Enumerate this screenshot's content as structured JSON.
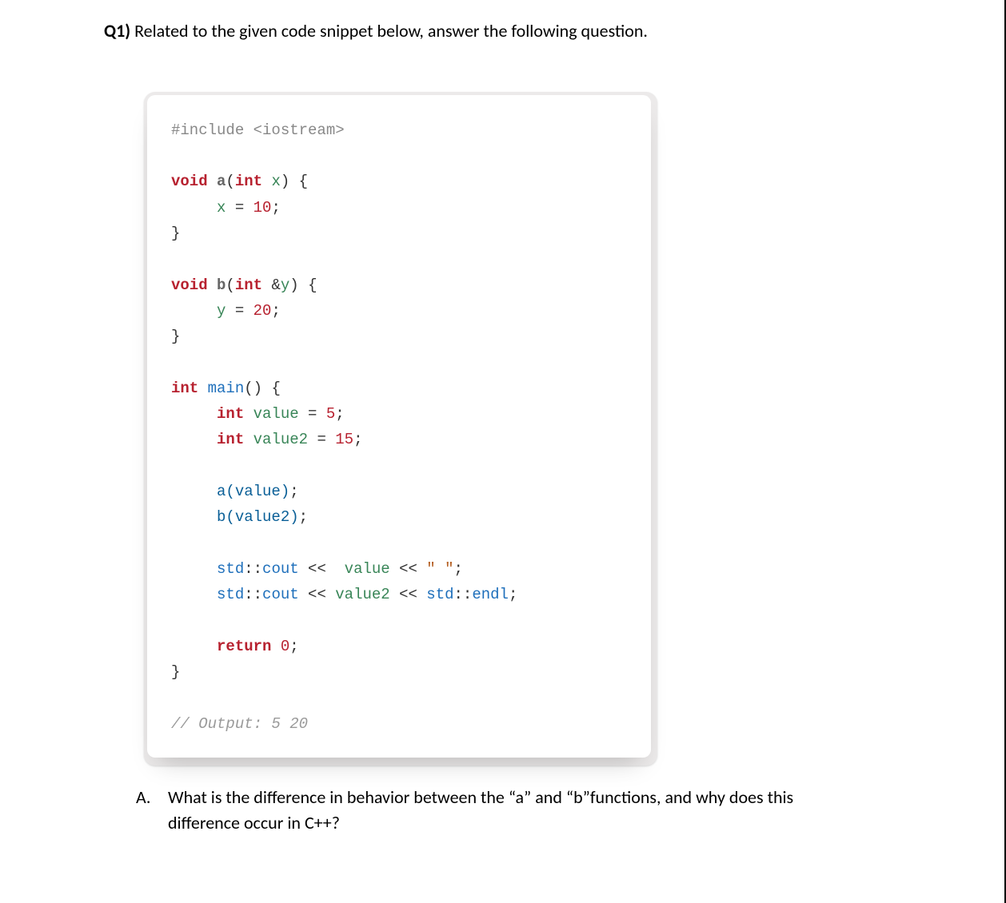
{
  "question": {
    "number": "Q1)",
    "prompt": "Related to the given code snippet below, answer the following question."
  },
  "code": {
    "l01_pp": "#include <iostream>",
    "l03_kw_void": "void",
    "l03_fn_a": "a",
    "l03_sig_open": "(",
    "l03_type_int": "int",
    "l03_param_x": "x",
    "l03_sig_close": ") {",
    "l04_var_x": "x",
    "l04_eq": " = ",
    "l04_num": "10",
    "l04_semi": ";",
    "l05_brace": "}",
    "l07_kw_void": "void",
    "l07_fn_b": "b",
    "l07_sig_open": "(",
    "l07_type_int": "int",
    "l07_amp": "&",
    "l07_param_y": "y",
    "l07_sig_close": ") {",
    "l08_var_y": "y",
    "l08_eq": " = ",
    "l08_num": "20",
    "l08_semi": ";",
    "l09_brace": "}",
    "l11_type_int": "int",
    "l11_fn_main": "main",
    "l11_sig": "() {",
    "l12_type_int": "int",
    "l12_var_value": "value",
    "l12_eq": " = ",
    "l12_num": "5",
    "l12_semi": ";",
    "l13_type_int": "int",
    "l13_var_value2": "value2",
    "l13_eq": " = ",
    "l13_num": "15",
    "l13_semi": ";",
    "l15_call_a": "a",
    "l15_arg": "(value)",
    "l15_semi": ";",
    "l16_call_b": "b",
    "l16_arg": "(value2)",
    "l16_semi": ";",
    "l18_ns_std": "std",
    "l18_scope": "::",
    "l18_cout": "cout",
    "l18_op": " << ",
    "l18_value": "value",
    "l18_op2": " << ",
    "l18_str": "\" \"",
    "l18_semi": ";",
    "l19_ns_std": "std",
    "l19_scope": "::",
    "l19_cout": "cout",
    "l19_op": " << ",
    "l19_value2": "value2",
    "l19_op2": " << ",
    "l19_ns_std2": "std",
    "l19_scope2": "::",
    "l19_endl": "endl",
    "l19_semi": ";",
    "l21_return": "return",
    "l21_zero": "0",
    "l21_semi": ";",
    "l22_brace": "}",
    "l24_cmt": "// Output: 5 20"
  },
  "subquestion": {
    "letter": "A.",
    "text": "What is the difference in behavior between the “a” and “b”functions, and why does this difference occur in C++?"
  }
}
